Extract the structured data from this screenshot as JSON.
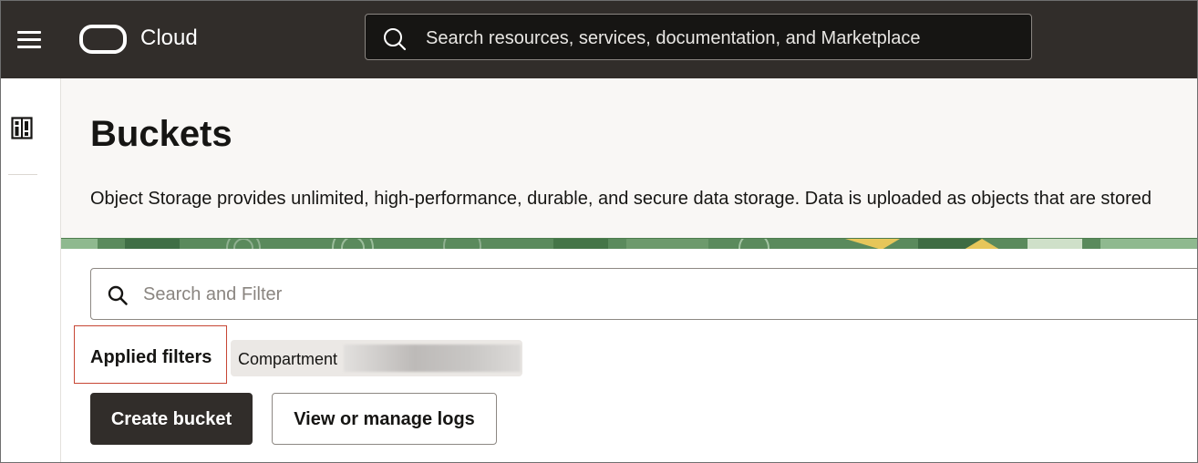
{
  "topbar": {
    "brand": "Cloud",
    "search_placeholder": "Search resources, services, documentation, and Marketplace"
  },
  "page": {
    "title": "Buckets",
    "description": "Object Storage provides unlimited, high-performance, durable, and secure data storage. Data is uploaded as objects that are stored"
  },
  "filter": {
    "placeholder": "Search and Filter",
    "applied_label": "Applied filters",
    "chip_label": "Compartment"
  },
  "actions": {
    "create_label": "Create bucket",
    "logs_label": "View or manage logs"
  },
  "icons": {
    "menu": "hamburger-menu-icon",
    "logo": "oracle-logo",
    "search": "search-icon",
    "rail": "panel-layout-icon",
    "filter_search": "search-icon"
  },
  "colors": {
    "topbar_bg": "#312d2a",
    "header_bg": "#f9f7f5",
    "primary_button": "#312d2a",
    "highlight_border": "#c74634"
  }
}
